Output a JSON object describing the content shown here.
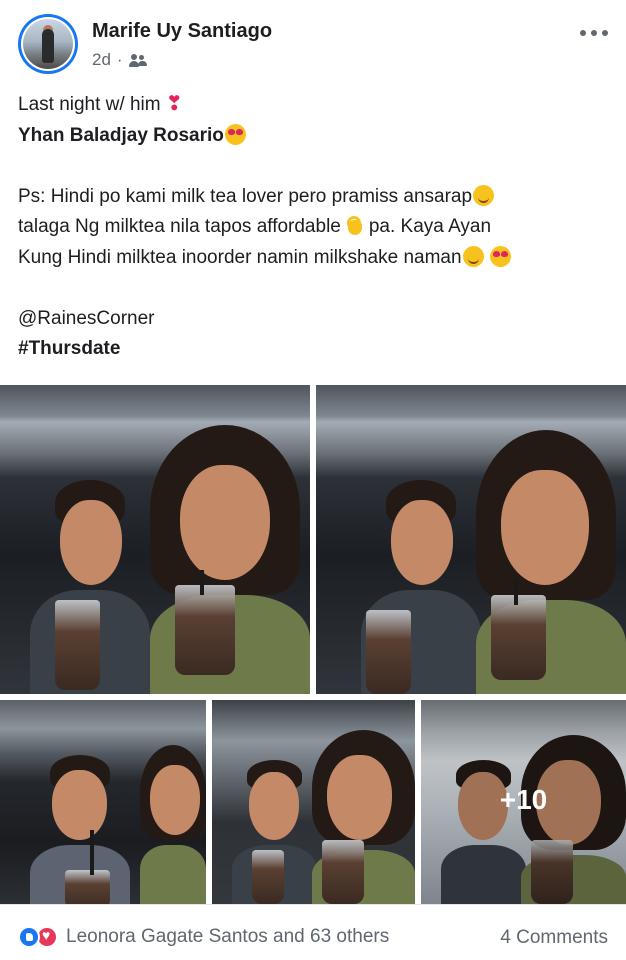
{
  "post": {
    "author": "Marife Uy Santiago",
    "time": "2d",
    "separator": "·",
    "audience_icon": "friends-icon",
    "text": {
      "line1": "Last night w/ him",
      "line2_name": "Yhan Baladjay Rosario",
      "line3": "Ps: Hindi po kami milk tea lover pero pramiss ansarap",
      "line4a": "talaga Ng milktea nila tapos affordable",
      "line4b": "pa. Kaya Ayan",
      "line5": "Kung Hindi milktea inoorder namin milkshake naman",
      "mention": "@RainesCorner",
      "hashtag": "#Thursdate"
    },
    "photos": {
      "more_count": "+10"
    },
    "footer": {
      "reactions_text": "Leonora Gagate Santos and 63 others",
      "comments": "4 Comments",
      "reaction_icons": [
        "like-icon",
        "love-icon"
      ]
    }
  },
  "colors": {
    "text": "#1c1e21",
    "secondary": "#606770",
    "accent": "#1877f2",
    "love": "#e8385a"
  }
}
